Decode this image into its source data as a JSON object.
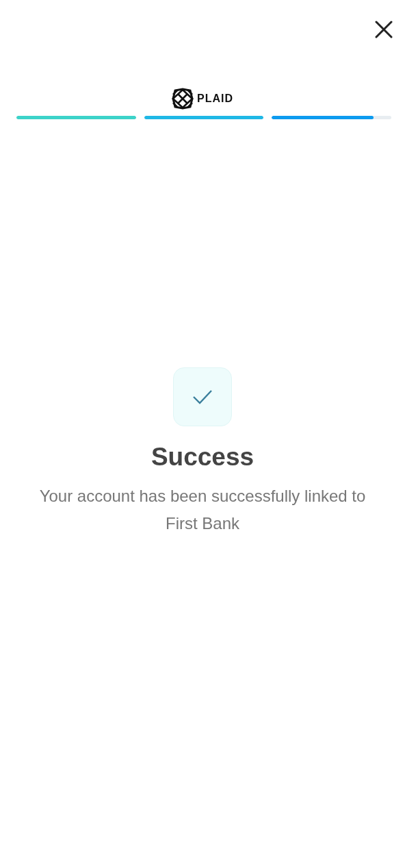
{
  "logo": {
    "text": "PLAID"
  },
  "progress": [
    {
      "level": 1,
      "color": "#3dd3c9"
    },
    {
      "level": 1,
      "color": "#1fb8e6"
    },
    {
      "level": 0.85,
      "color": "#0d9bef"
    }
  ],
  "title": "Success",
  "message": "Your account has been successfully linked to First Bank"
}
